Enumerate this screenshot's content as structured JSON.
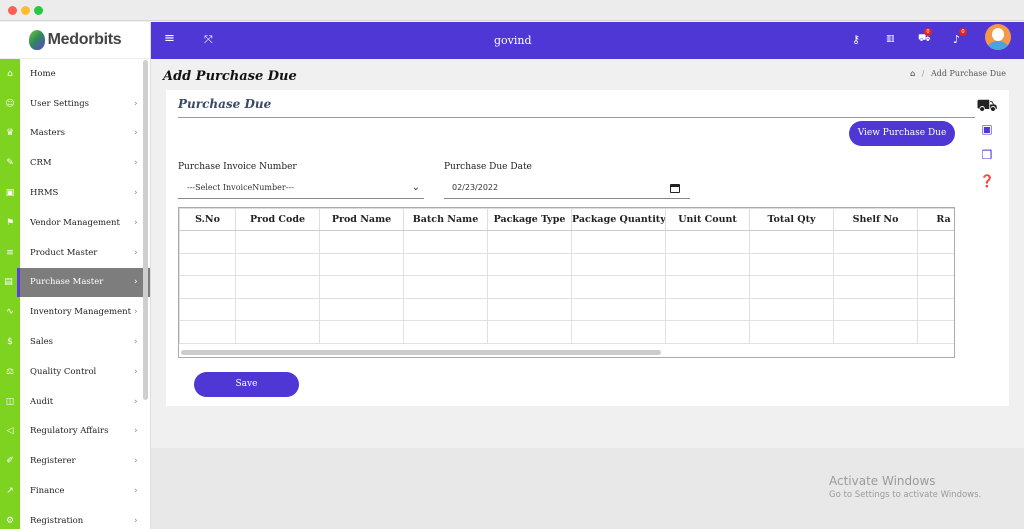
{
  "app": {
    "logo_text": "Medorbits"
  },
  "colors": {
    "primary": "#4f37d6",
    "sidebar_icon": "#7ed321",
    "active_item": "#7d7d7d",
    "badge": "#e0261e"
  },
  "topbar": {
    "user": "govind",
    "icons": [
      "menu-icon",
      "expand-icon",
      "key-icon",
      "translate-icon",
      "cart-icon",
      "bell-icon"
    ],
    "cart_badge": "0",
    "bell_badge": "0"
  },
  "sidebar": {
    "items": [
      {
        "label": "Home",
        "icon": "⌂",
        "arrow": ""
      },
      {
        "label": "User Settings",
        "icon": "☺",
        "arrow": "›"
      },
      {
        "label": "Masters",
        "icon": "♛",
        "arrow": "›"
      },
      {
        "label": "CRM",
        "icon": "✎",
        "arrow": "›"
      },
      {
        "label": "HRMS",
        "icon": "▣",
        "arrow": "›"
      },
      {
        "label": "Vendor Management",
        "icon": "⚑",
        "arrow": "›"
      },
      {
        "label": "Product Master",
        "icon": "≡",
        "arrow": "›"
      },
      {
        "label": "Purchase Master",
        "icon": "▤",
        "arrow": "›",
        "active": true
      },
      {
        "label": "Inventory Management",
        "icon": "∿",
        "arrow": "›"
      },
      {
        "label": "Sales",
        "icon": "$",
        "arrow": "›"
      },
      {
        "label": "Quality Control",
        "icon": "⚖",
        "arrow": "›"
      },
      {
        "label": "Audit",
        "icon": "◫",
        "arrow": "›"
      },
      {
        "label": "Regulatory Affairs",
        "icon": "◁",
        "arrow": "›"
      },
      {
        "label": "Registerer",
        "icon": "✐",
        "arrow": "›"
      },
      {
        "label": "Finance",
        "icon": "↗",
        "arrow": "›"
      },
      {
        "label": "Registration",
        "icon": "⚙",
        "arrow": "›"
      }
    ]
  },
  "page": {
    "title": "Add Purchase Due",
    "breadcrumb_current": "Add Purchase Due",
    "card_title": "Purchase Due",
    "view_button": "View Purchase Due",
    "invoice_label": "Purchase Invoice Number",
    "invoice_value": "---Select InvoiceNumber---",
    "date_label": "Purchase Due Date",
    "date_value": "02/23/2022",
    "columns": [
      "S.No",
      "Prod Code",
      "Prod Name",
      "Batch Name",
      "Package Type",
      "Package Quantity",
      "Unit Count",
      "Total Qty",
      "Shelf No",
      "Ra"
    ],
    "empty_rows": 5,
    "save_button": "Save"
  },
  "watermark": {
    "title": "Activate Windows",
    "subtitle": "Go to Settings to activate Windows."
  }
}
